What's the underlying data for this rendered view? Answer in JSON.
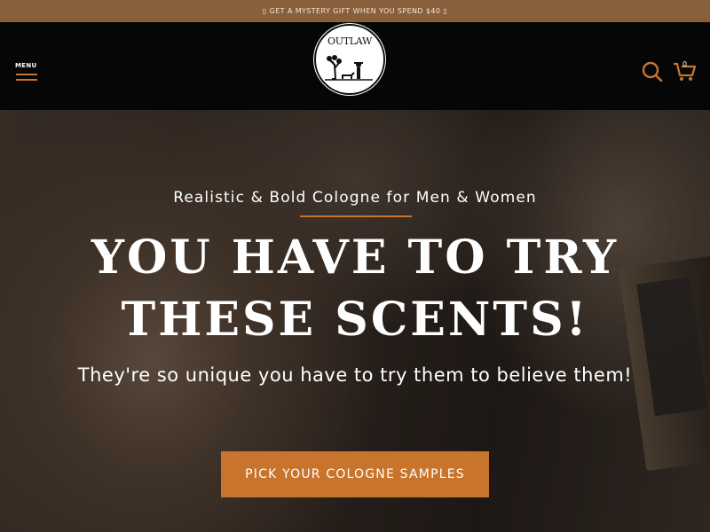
{
  "promo": {
    "text": "GET A MYSTERY GIFT WHEN YOU SPEND $40",
    "glyph_left": "▯",
    "glyph_right": "▯"
  },
  "header": {
    "menu_label": "MENU",
    "logo_text": "OUTLAW",
    "cart_count": "0",
    "icons": {
      "search": "search-icon",
      "cart": "cart-icon",
      "menu": "hamburger-icon"
    },
    "accent_color": "#c8742c"
  },
  "hero": {
    "eyebrow": "Realistic & Bold Cologne for Men & Women",
    "headline_line1": "YOU HAVE TO TRY",
    "headline_line2": "THESE SCENTS!",
    "subtext": "They're so unique you have to try them to believe them!",
    "cta_label": "PICK YOUR COLOGNE SAMPLES"
  },
  "colors": {
    "promo_bg": "#8a5f3c",
    "header_bg": "#060606",
    "cta_bg": "#c8742c"
  }
}
